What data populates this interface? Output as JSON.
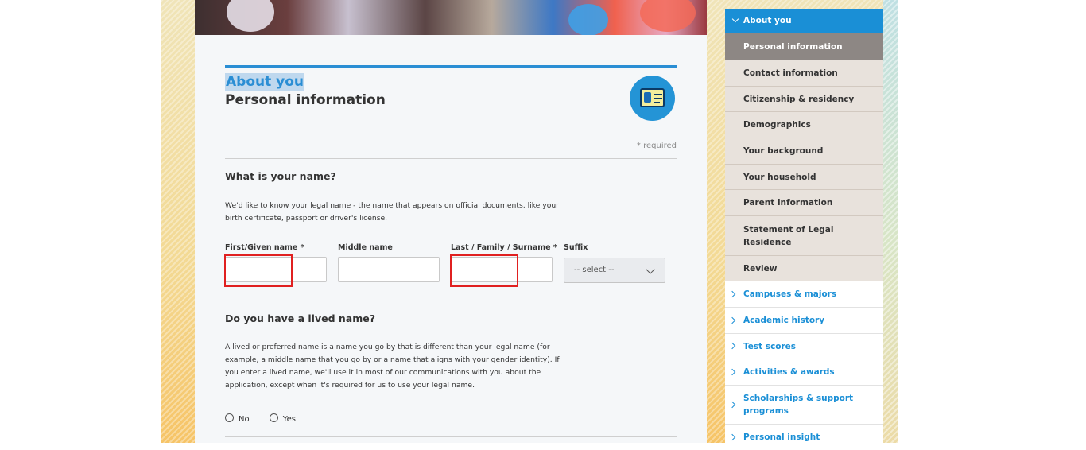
{
  "header": {
    "section_label": "About you",
    "page_title": "Personal information",
    "required_note": "* required"
  },
  "name_question": {
    "title": "What is your name?",
    "help": "We'd like to know your legal name - the name that appears on official documents, like your birth certificate, passport or driver's license.",
    "fields": {
      "first_label": "First/Given name *",
      "first_value": "",
      "middle_label": "Middle name",
      "middle_value": "",
      "last_label": "Last / Family / Surname *",
      "last_value": "",
      "suffix_label": "Suffix",
      "suffix_selected": "-- select --"
    }
  },
  "lived_name_question": {
    "title": "Do you have a lived name?",
    "help": "A lived or preferred name is a name you go by that is different than your legal name (for example, a middle name that you go by or a name that aligns with your gender identity). If you enter a lived name, we'll use it in most of our communications with you about the application, except when it's required for us to use your legal name.",
    "options": [
      "No",
      "Yes"
    ]
  },
  "sidebar": {
    "header": "About you",
    "sub_items": [
      {
        "label": "Personal information",
        "active": true
      },
      {
        "label": "Contact information"
      },
      {
        "label": "Citizenship & residency"
      },
      {
        "label": "Demographics"
      },
      {
        "label": "Your background"
      },
      {
        "label": "Your household"
      },
      {
        "label": "Parent information"
      },
      {
        "label": "Statement of Legal Residence"
      },
      {
        "label": "Review"
      }
    ],
    "main_items": [
      {
        "label": "Campuses & majors"
      },
      {
        "label": "Academic history"
      },
      {
        "label": "Test scores"
      },
      {
        "label": "Activities & awards"
      },
      {
        "label": "Scholarships & support programs"
      },
      {
        "label": "Personal insight"
      }
    ]
  },
  "colors": {
    "accent_blue": "#1a8fd6",
    "active_item": "#8d8784",
    "error_highlight": "#e02020"
  }
}
